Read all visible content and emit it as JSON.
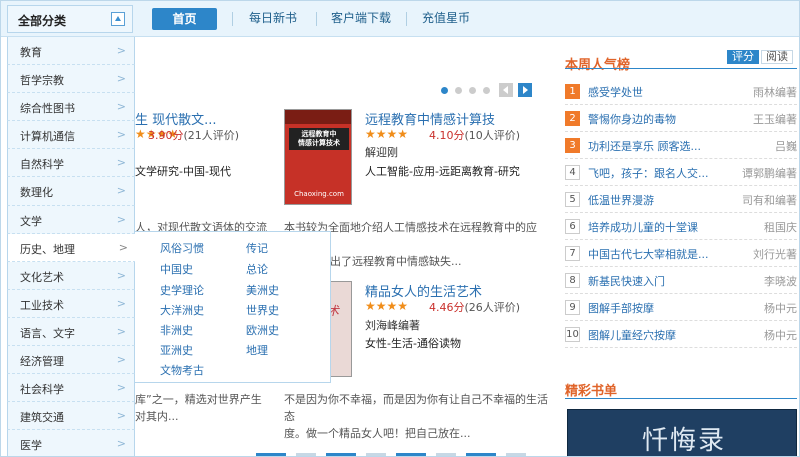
{
  "header": {
    "all_categories": "全部分类",
    "nav": [
      {
        "label": "首页"
      },
      {
        "label": "每日新书"
      },
      {
        "label": "客户端下载"
      },
      {
        "label": "充值星币"
      }
    ]
  },
  "categories": [
    "教育",
    "哲学宗教",
    "综合性图书",
    "计算机通信",
    "自然科学",
    "数理化",
    "文学",
    "历史、地理",
    "文化艺术",
    "工业技术",
    "语言、文字",
    "经济管理",
    "社会科学",
    "建筑交通",
    "医学"
  ],
  "active_category": "历史、地理",
  "submenu": [
    "风俗习惯",
    "传记",
    "中国史",
    "总论",
    "史学理论",
    "美洲史",
    "大洋洲史",
    "世界史",
    "非洲史",
    "欧洲史",
    "亚洲史",
    "地理",
    "文物考古"
  ],
  "carousel": {
    "active_index": 0,
    "dot_count": 4
  },
  "books": [
    {
      "title": "生 现代散文...",
      "rating_text": "3.90分",
      "count_text": "(21人评价)",
      "tags": "文学研究-中国-现代",
      "desc": "人，对现代散文语体的交流"
    },
    {
      "title": "远程教育中情感计算技",
      "rating_text": "4.10分",
      "count_text": "(10人评价)",
      "author": "解迎刚",
      "tags": "人工智能-应用-远距离教育-研究",
      "desc_line1": "本书较为全面地介绍人工情感技术在远程教育中的应用。",
      "desc_line2": "出了远程教育中情感缺失...",
      "cover": {
        "title": "远程教育中\n情感计算技术",
        "site": "Chaoxing.com"
      }
    },
    {
      "title": "精品女人的生活艺术",
      "rating_text": "4.46分",
      "count_text": "(26人评价)",
      "author": "刘海峰编著",
      "tags": "女性-生活-通俗读物",
      "desc_line1": "不是因为你不幸福，而是因为你有让自己不幸福的生活态",
      "desc_line2": "度。做一个精品女人吧！把自己放在...",
      "cover": {
        "text": "艺术"
      }
    },
    {
      "desc_line1": "库”之一，精选对世界产生",
      "desc_line2": "对其内..."
    }
  ],
  "stars": "★★★★",
  "rank": {
    "title": "本周人气榜",
    "tabs": [
      "评分",
      "阅读"
    ],
    "items": [
      {
        "num": "1",
        "title": "感受学处世",
        "author": "雨林编著"
      },
      {
        "num": "2",
        "title": "警惕你身边的毒物",
        "author": "王玉编著"
      },
      {
        "num": "3",
        "title": "功利还是享乐 顾客选...",
        "author": "吕巍"
      },
      {
        "num": "4",
        "title": "飞吧，孩子：跟名人交...",
        "author": "谭郭鹏编著"
      },
      {
        "num": "5",
        "title": "低温世界漫游",
        "author": "司有和编著"
      },
      {
        "num": "6",
        "title": "培养成功儿童的十堂课",
        "author": "租国庆"
      },
      {
        "num": "7",
        "title": "中国古代七大宰相就是...",
        "author": "刘行光著"
      },
      {
        "num": "8",
        "title": "新基民快速入门",
        "author": "李晓波"
      },
      {
        "num": "9",
        "title": "图解手部按摩",
        "author": "杨中元"
      },
      {
        "num": "10",
        "title": "图解儿童经穴按摩",
        "author": "杨中元"
      }
    ]
  },
  "featured": {
    "title": "精彩书单",
    "book_title": "忏悔录"
  }
}
